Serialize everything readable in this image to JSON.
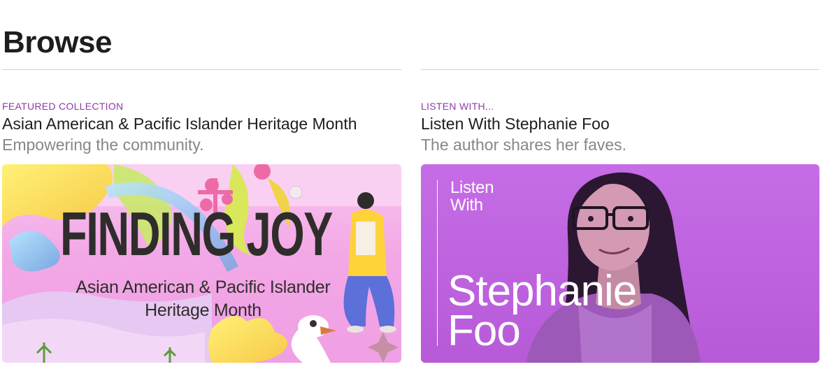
{
  "header": {
    "title": "Browse"
  },
  "cards": [
    {
      "eyebrow": "FEATURED COLLECTION",
      "title": "Asian American & Pacific Islander Heritage Month",
      "subtitle": "Empowering the community.",
      "artwork": {
        "headline": "FINDING JOY",
        "subline_1": "Asian American & Pacific Islander",
        "subline_2": "Heritage Month"
      }
    },
    {
      "eyebrow": "LISTEN WITH...",
      "title": "Listen With Stephanie Foo",
      "subtitle": "The author shares her faves.",
      "artwork": {
        "small_line_1": "Listen",
        "small_line_2": "With",
        "big_line_1": "Stephanie",
        "big_line_2": "Foo"
      }
    }
  ],
  "colors": {
    "eyebrow": "#8f3aa8",
    "subtitle": "#86868b",
    "divider": "#d2d2d7",
    "art_purple": "#b75ad8",
    "art_pink": "#f3a8e6"
  }
}
